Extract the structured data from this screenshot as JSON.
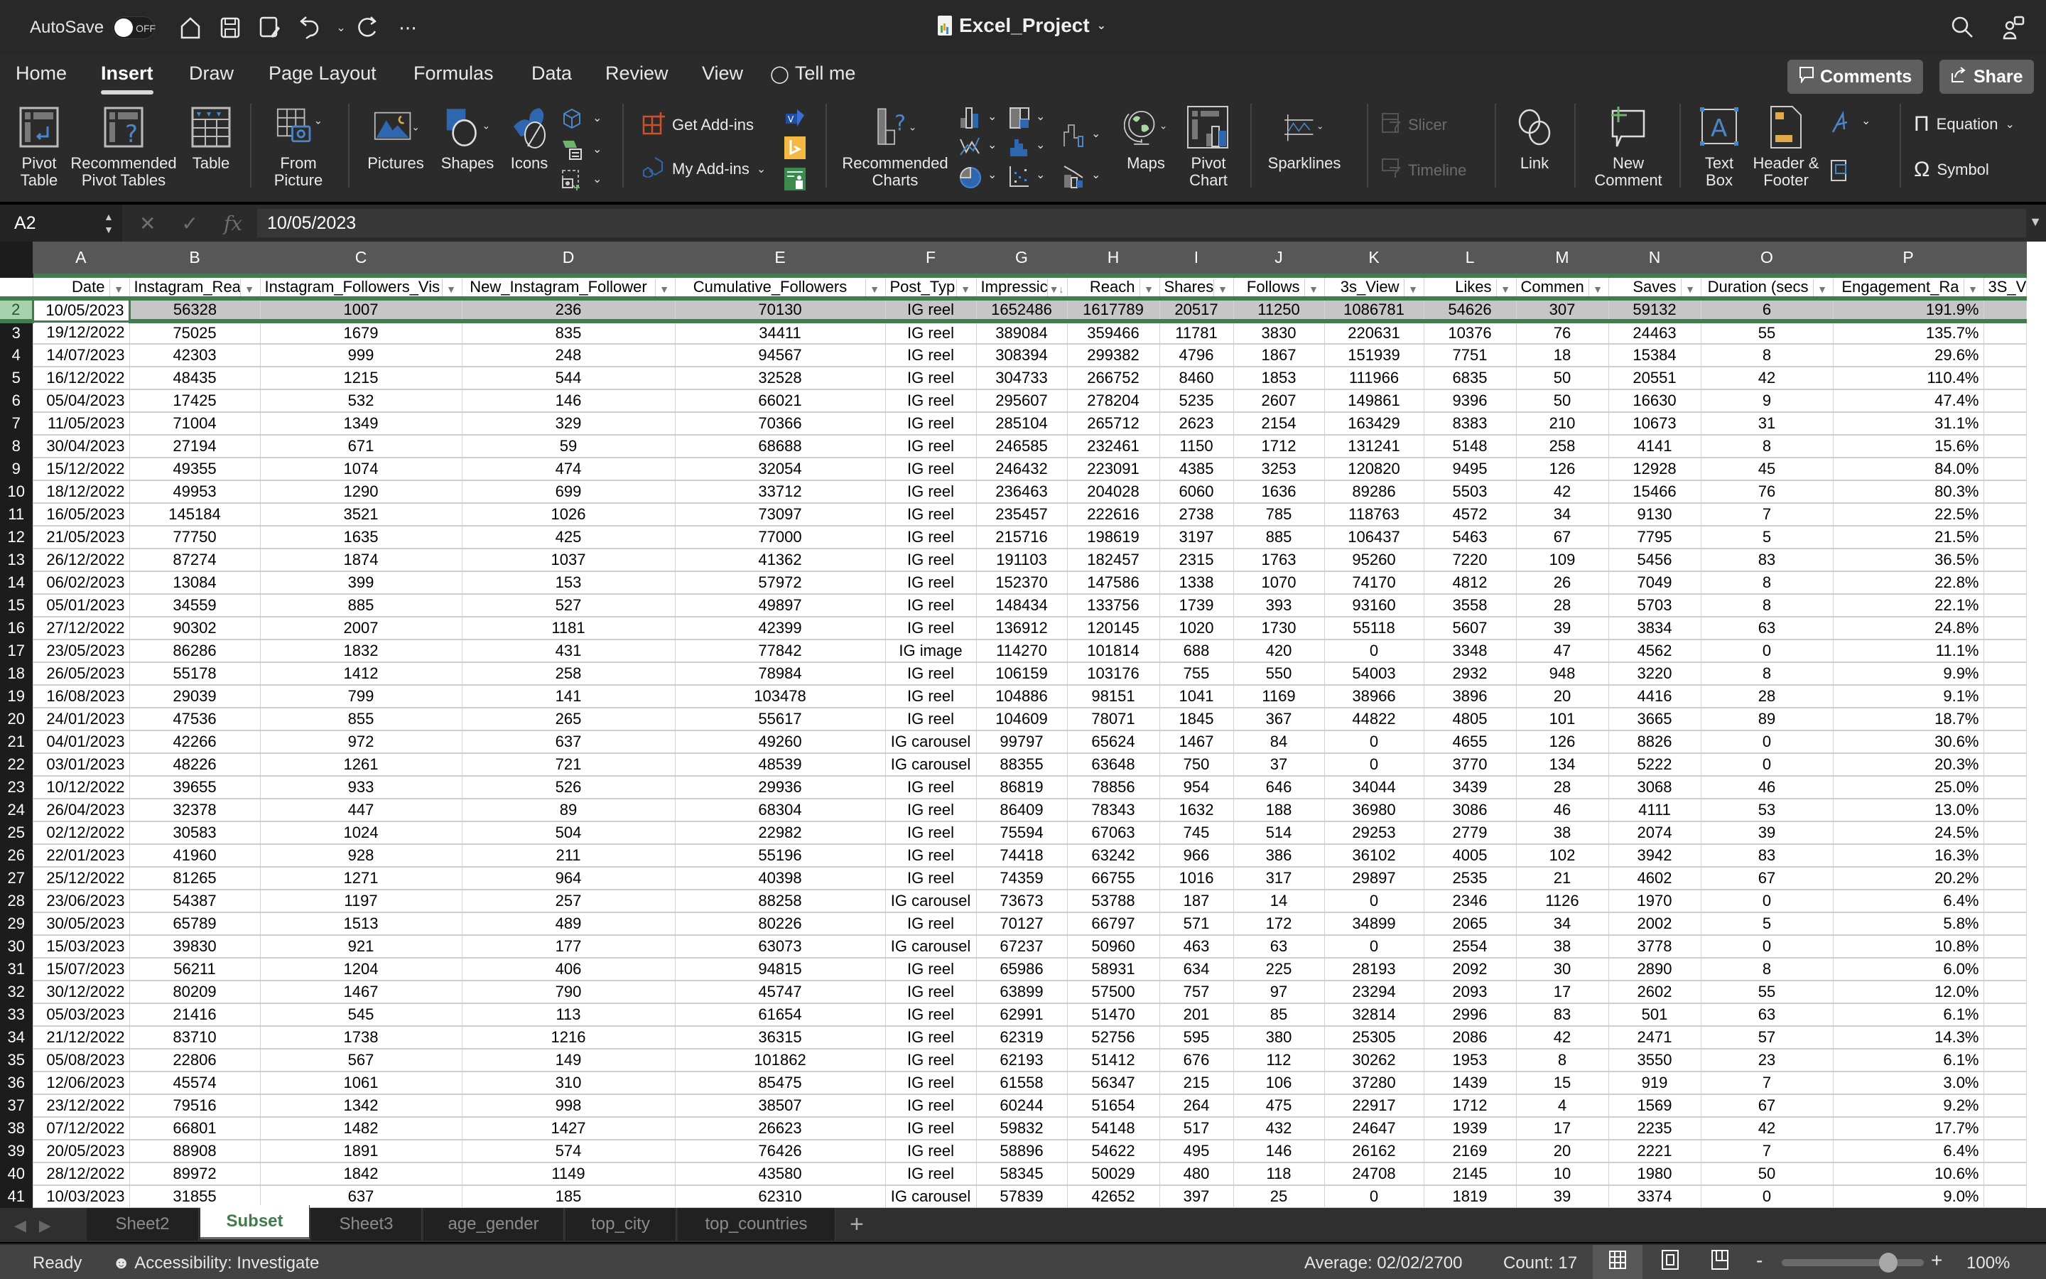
{
  "app": {
    "autosave_label": "AutoSave",
    "autosave_state": "OFF",
    "doc_title": "Excel_Project"
  },
  "menu": {
    "tabs": [
      "Home",
      "Insert",
      "Draw",
      "Page Layout",
      "Formulas",
      "Data",
      "Review",
      "View",
      "Tell me"
    ],
    "active_tab": "Insert",
    "comments_label": "Comments",
    "share_label": "Share"
  },
  "ribbon": {
    "pivot_table": "Pivot\nTable",
    "recommended_pivot": "Recommended\nPivot Tables",
    "table": "Table",
    "from_picture": "From\nPicture",
    "pictures": "Pictures",
    "shapes": "Shapes",
    "icons": "Icons",
    "get_addins": "Get Add-ins",
    "my_addins": "My Add-ins",
    "recommended_charts": "Recommended\nCharts",
    "maps": "Maps",
    "pivot_chart": "Pivot\nChart",
    "sparklines": "Sparklines",
    "slicer": "Slicer",
    "timeline": "Timeline",
    "link": "Link",
    "new_comment": "New\nComment",
    "text_box": "Text\nBox",
    "header_footer": "Header &\nFooter",
    "equation": "Equation",
    "symbol": "Symbol"
  },
  "formula_bar": {
    "name_box": "A2",
    "fx_label": "fx",
    "value": "10/05/2023"
  },
  "grid": {
    "column_letters": [
      "A",
      "B",
      "C",
      "D",
      "E",
      "F",
      "G",
      "H",
      "I",
      "J",
      "K",
      "L",
      "M",
      "N",
      "O",
      "P",
      ""
    ],
    "headers": [
      "Date",
      "Instagram_Rea",
      "Instagram_Followers_Vis",
      "New_Instagram_Follower",
      "Cumulative_Followers",
      "Post_Typ",
      "Impressic",
      "Reach",
      "Shares",
      "Follows",
      "3s_View",
      "Likes",
      "Commen",
      "Saves",
      "Duration (secs",
      "Engagement_Ra",
      "3S_V"
    ],
    "sorted_column": "Impressic",
    "selected_row": 2,
    "rows": [
      [
        "10/05/2023",
        "56328",
        "1007",
        "236",
        "70130",
        "IG reel",
        "1652486",
        "1617789",
        "20517",
        "11250",
        "1086781",
        "54626",
        "307",
        "59132",
        "6",
        "191.9%",
        ""
      ],
      [
        "19/12/2022",
        "75025",
        "1679",
        "835",
        "34411",
        "IG reel",
        "389084",
        "359466",
        "11781",
        "3830",
        "220631",
        "10376",
        "76",
        "24463",
        "55",
        "135.7%",
        ""
      ],
      [
        "14/07/2023",
        "42303",
        "999",
        "248",
        "94567",
        "IG reel",
        "308394",
        "299382",
        "4796",
        "1867",
        "151939",
        "7751",
        "18",
        "15384",
        "8",
        "29.6%",
        ""
      ],
      [
        "16/12/2022",
        "48435",
        "1215",
        "544",
        "32528",
        "IG reel",
        "304733",
        "266752",
        "8460",
        "1853",
        "111966",
        "6835",
        "50",
        "20551",
        "42",
        "110.4%",
        ""
      ],
      [
        "05/04/2023",
        "17425",
        "532",
        "146",
        "66021",
        "IG reel",
        "295607",
        "278204",
        "5235",
        "2607",
        "149861",
        "9396",
        "50",
        "16630",
        "9",
        "47.4%",
        ""
      ],
      [
        "11/05/2023",
        "71004",
        "1349",
        "329",
        "70366",
        "IG reel",
        "285104",
        "265712",
        "2623",
        "2154",
        "163429",
        "8383",
        "210",
        "10673",
        "31",
        "31.1%",
        ""
      ],
      [
        "30/04/2023",
        "27194",
        "671",
        "59",
        "68688",
        "IG reel",
        "246585",
        "232461",
        "1150",
        "1712",
        "131241",
        "5148",
        "258",
        "4141",
        "8",
        "15.6%",
        ""
      ],
      [
        "15/12/2022",
        "49355",
        "1074",
        "474",
        "32054",
        "IG reel",
        "246432",
        "223091",
        "4385",
        "3253",
        "120820",
        "9495",
        "126",
        "12928",
        "45",
        "84.0%",
        ""
      ],
      [
        "18/12/2022",
        "49953",
        "1290",
        "699",
        "33712",
        "IG reel",
        "236463",
        "204028",
        "6060",
        "1636",
        "89286",
        "5503",
        "42",
        "15466",
        "76",
        "80.3%",
        ""
      ],
      [
        "16/05/2023",
        "145184",
        "3521",
        "1026",
        "73097",
        "IG reel",
        "235457",
        "222616",
        "2738",
        "785",
        "118763",
        "4572",
        "34",
        "9130",
        "7",
        "22.5%",
        ""
      ],
      [
        "21/05/2023",
        "77750",
        "1635",
        "425",
        "77000",
        "IG reel",
        "215716",
        "198619",
        "3197",
        "885",
        "106437",
        "5463",
        "67",
        "7795",
        "5",
        "21.5%",
        ""
      ],
      [
        "26/12/2022",
        "87274",
        "1874",
        "1037",
        "41362",
        "IG reel",
        "191103",
        "182457",
        "2315",
        "1763",
        "95260",
        "7220",
        "109",
        "5456",
        "83",
        "36.5%",
        ""
      ],
      [
        "06/02/2023",
        "13084",
        "399",
        "153",
        "57972",
        "IG reel",
        "152370",
        "147586",
        "1338",
        "1070",
        "74170",
        "4812",
        "26",
        "7049",
        "8",
        "22.8%",
        ""
      ],
      [
        "05/01/2023",
        "34559",
        "885",
        "527",
        "49897",
        "IG reel",
        "148434",
        "133756",
        "1739",
        "393",
        "93160",
        "3558",
        "28",
        "5703",
        "8",
        "22.1%",
        ""
      ],
      [
        "27/12/2022",
        "90302",
        "2007",
        "1181",
        "42399",
        "IG reel",
        "136912",
        "120145",
        "1020",
        "1730",
        "55118",
        "5607",
        "39",
        "3834",
        "63",
        "24.8%",
        ""
      ],
      [
        "23/05/2023",
        "86286",
        "1832",
        "431",
        "77842",
        "IG image",
        "114270",
        "101814",
        "688",
        "420",
        "0",
        "3348",
        "47",
        "4562",
        "0",
        "11.1%",
        ""
      ],
      [
        "26/05/2023",
        "55178",
        "1412",
        "258",
        "78984",
        "IG reel",
        "106159",
        "103176",
        "755",
        "550",
        "54003",
        "2932",
        "948",
        "3220",
        "8",
        "9.9%",
        ""
      ],
      [
        "16/08/2023",
        "29039",
        "799",
        "141",
        "103478",
        "IG reel",
        "104886",
        "98151",
        "1041",
        "1169",
        "38966",
        "3896",
        "20",
        "4416",
        "28",
        "9.1%",
        ""
      ],
      [
        "24/01/2023",
        "47536",
        "855",
        "265",
        "55617",
        "IG reel",
        "104609",
        "78071",
        "1845",
        "367",
        "44822",
        "4805",
        "101",
        "3665",
        "89",
        "18.7%",
        ""
      ],
      [
        "04/01/2023",
        "42266",
        "972",
        "637",
        "49260",
        "IG carousel",
        "99797",
        "65624",
        "1467",
        "84",
        "0",
        "4655",
        "126",
        "8826",
        "0",
        "30.6%",
        ""
      ],
      [
        "03/01/2023",
        "48226",
        "1261",
        "721",
        "48539",
        "IG carousel",
        "88355",
        "63648",
        "750",
        "37",
        "0",
        "3770",
        "134",
        "5222",
        "0",
        "20.3%",
        ""
      ],
      [
        "10/12/2022",
        "39655",
        "933",
        "526",
        "29936",
        "IG reel",
        "86819",
        "78856",
        "954",
        "646",
        "34044",
        "3439",
        "28",
        "3068",
        "46",
        "25.0%",
        ""
      ],
      [
        "26/04/2023",
        "32378",
        "447",
        "89",
        "68304",
        "IG reel",
        "86409",
        "78343",
        "1632",
        "188",
        "36980",
        "3086",
        "46",
        "4111",
        "53",
        "13.0%",
        ""
      ],
      [
        "02/12/2022",
        "30583",
        "1024",
        "504",
        "22982",
        "IG reel",
        "75594",
        "67063",
        "745",
        "514",
        "29253",
        "2779",
        "38",
        "2074",
        "39",
        "24.5%",
        ""
      ],
      [
        "22/01/2023",
        "41960",
        "928",
        "211",
        "55196",
        "IG reel",
        "74418",
        "63242",
        "966",
        "386",
        "36102",
        "4005",
        "102",
        "3942",
        "83",
        "16.3%",
        ""
      ],
      [
        "25/12/2022",
        "81265",
        "1271",
        "964",
        "40398",
        "IG reel",
        "74359",
        "66755",
        "1016",
        "317",
        "29897",
        "2535",
        "21",
        "4602",
        "67",
        "20.2%",
        ""
      ],
      [
        "23/06/2023",
        "54387",
        "1197",
        "257",
        "88258",
        "IG carousel",
        "73673",
        "53788",
        "187",
        "14",
        "0",
        "2346",
        "1126",
        "1970",
        "0",
        "6.4%",
        ""
      ],
      [
        "30/05/2023",
        "65789",
        "1513",
        "489",
        "80226",
        "IG reel",
        "70127",
        "66797",
        "571",
        "172",
        "34899",
        "2065",
        "34",
        "2002",
        "5",
        "5.8%",
        ""
      ],
      [
        "15/03/2023",
        "39830",
        "921",
        "177",
        "63073",
        "IG carousel",
        "67237",
        "50960",
        "463",
        "63",
        "0",
        "2554",
        "38",
        "3778",
        "0",
        "10.8%",
        ""
      ],
      [
        "15/07/2023",
        "56211",
        "1204",
        "406",
        "94815",
        "IG reel",
        "65986",
        "58931",
        "634",
        "225",
        "28193",
        "2092",
        "30",
        "2890",
        "8",
        "6.0%",
        ""
      ],
      [
        "30/12/2022",
        "80209",
        "1467",
        "790",
        "45747",
        "IG reel",
        "63899",
        "57500",
        "757",
        "97",
        "23294",
        "2093",
        "17",
        "2602",
        "55",
        "12.0%",
        ""
      ],
      [
        "05/03/2023",
        "21416",
        "545",
        "113",
        "61654",
        "IG reel",
        "62991",
        "51470",
        "201",
        "85",
        "32814",
        "2996",
        "83",
        "501",
        "63",
        "6.1%",
        ""
      ],
      [
        "21/12/2022",
        "83710",
        "1738",
        "1216",
        "36315",
        "IG reel",
        "62319",
        "52756",
        "595",
        "380",
        "25305",
        "2086",
        "42",
        "2471",
        "57",
        "14.3%",
        ""
      ],
      [
        "05/08/2023",
        "22806",
        "567",
        "149",
        "101862",
        "IG reel",
        "62193",
        "51412",
        "676",
        "112",
        "30262",
        "1953",
        "8",
        "3550",
        "23",
        "6.1%",
        ""
      ],
      [
        "12/06/2023",
        "45574",
        "1061",
        "310",
        "85475",
        "IG reel",
        "61558",
        "56347",
        "215",
        "106",
        "37280",
        "1439",
        "15",
        "919",
        "7",
        "3.0%",
        ""
      ],
      [
        "23/12/2022",
        "79516",
        "1342",
        "998",
        "38507",
        "IG reel",
        "60244",
        "51654",
        "264",
        "475",
        "22917",
        "1712",
        "4",
        "1569",
        "67",
        "9.2%",
        ""
      ],
      [
        "07/12/2022",
        "66801",
        "1482",
        "1427",
        "26623",
        "IG reel",
        "59832",
        "54148",
        "517",
        "432",
        "24647",
        "1939",
        "17",
        "2235",
        "42",
        "17.7%",
        ""
      ],
      [
        "20/05/2023",
        "88908",
        "1891",
        "574",
        "76426",
        "IG reel",
        "58896",
        "54622",
        "495",
        "146",
        "26162",
        "2169",
        "20",
        "2221",
        "7",
        "6.4%",
        ""
      ],
      [
        "28/12/2022",
        "89972",
        "1842",
        "1149",
        "43580",
        "IG reel",
        "58345",
        "50029",
        "480",
        "118",
        "24708",
        "2145",
        "10",
        "1980",
        "50",
        "10.6%",
        ""
      ],
      [
        "10/03/2023",
        "31855",
        "637",
        "185",
        "62310",
        "IG carousel",
        "57839",
        "42652",
        "397",
        "25",
        "0",
        "1819",
        "39",
        "3374",
        "0",
        "9.0%",
        ""
      ]
    ]
  },
  "sheets": {
    "tabs": [
      "Sheet2",
      "Subset",
      "Sheet3",
      "age_gender",
      "top_city",
      "top_countries"
    ],
    "active": "Subset"
  },
  "status": {
    "ready": "Ready",
    "accessibility": "Accessibility: Investigate",
    "average": "Average: 02/02/2700",
    "count": "Count: 17",
    "zoom_percent": 100,
    "zoom_label": "100%"
  },
  "colors": {
    "accent_green": "#3f7d4f",
    "ribbon_blue": "#4a86c8"
  }
}
